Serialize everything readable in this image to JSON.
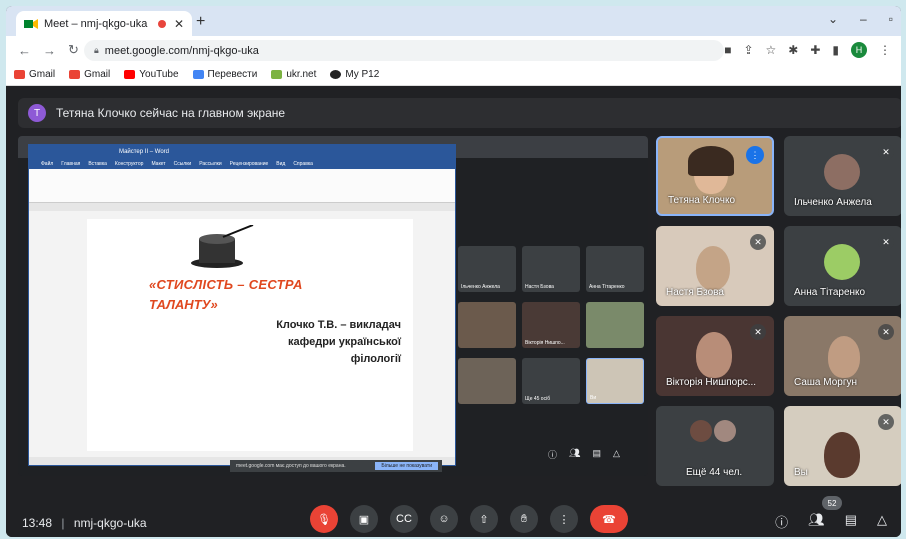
{
  "browser": {
    "tab_title": "Meet – nmj-qkgo-uka",
    "new_tab": "+",
    "url": "meet.google.com/nmj-qkgo-uka",
    "profile_initial": "H",
    "bookmarks": [
      "Gmail",
      "Gmail",
      "YouTube",
      "Перевести",
      "ukr.net",
      "My P12"
    ]
  },
  "meet": {
    "banner_avatar": "T",
    "banner_text": "Тетяна Клочко сейчас на главном экране",
    "meeting_time": "13:48",
    "meeting_code": "nmj-qkgo-uka",
    "participant_count": "52",
    "more_label": "Ещё 44 чел."
  },
  "presentation": {
    "title_line1": "«СТИСЛІСТЬ – СЕСТРА",
    "title_line2": "ТАЛАНТУ»",
    "author_line1": "Клочко Т.В. – викладач",
    "author_line2": "кафедри української",
    "author_line3": "філології",
    "cookie_text": "meet.google.com має доступ до вашого екрана.",
    "cookie_button": "Більше не показувати",
    "word_title": "Майстер ІІ – Word",
    "word_tabs": [
      "Файл",
      "Главная",
      "Вставка",
      "Конструктор",
      "Макет",
      "Ссылки",
      "Рассылки",
      "Рецензирование",
      "Вид",
      "Справка"
    ],
    "inner_tiles": [
      "Ільченко Анжела",
      "Настя Бзова",
      "Анна Тітаренко",
      "Вікторія Нишпо...",
      "Ще 45 осіб",
      "Ви"
    ]
  },
  "tiles": [
    {
      "name": "Тетяна Клочко",
      "speaking": true
    },
    {
      "name": "Ільченко Анжела",
      "speaking": false
    },
    {
      "name": "Настя Бзова",
      "speaking": false
    },
    {
      "name": "Анна Тітаренко",
      "speaking": false
    },
    {
      "name": "Вікторія Нишпорс...",
      "speaking": false
    },
    {
      "name": "Саша Моргун",
      "speaking": false
    },
    {
      "name": "Ещё 44 чел.",
      "speaking": false
    },
    {
      "name": "Вы",
      "speaking": false
    }
  ],
  "colors": {
    "accent": "#1a73e8",
    "end_call": "#ea4335",
    "title_orange": "#e0481f",
    "meet_bg": "#202124"
  }
}
